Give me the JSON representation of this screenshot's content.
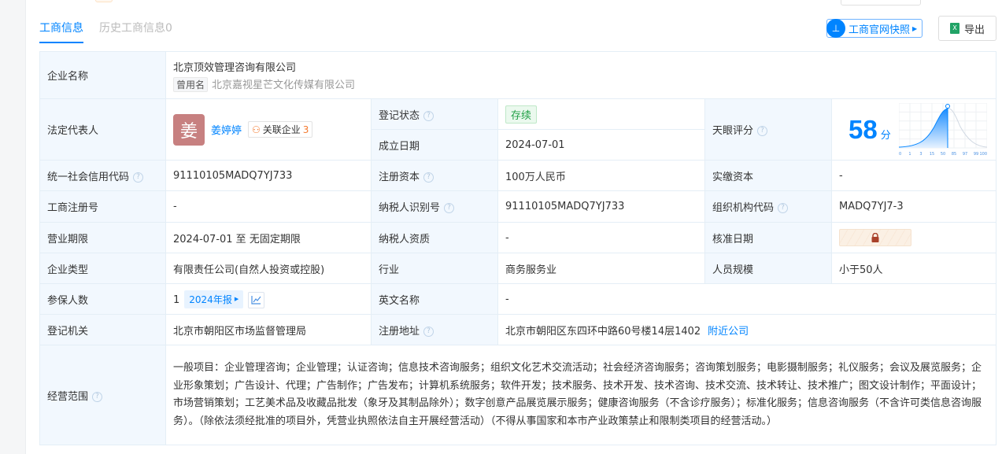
{
  "tabs": [
    {
      "label": "工商信息"
    },
    {
      "label": "历史工商信息0"
    }
  ],
  "actions": {
    "snapshot": "工商官网快照",
    "export": "导出"
  },
  "company": {
    "label": "企业名称",
    "name": "北京顶效管理咨询有限公司",
    "used_name_tag": "曾用名",
    "used_name": "北京嘉视星芒文化传媒有限公司"
  },
  "legal": {
    "label": "法定代表人",
    "avatar_char": "姜",
    "name": "姜婷婷",
    "related_label": "关联企业",
    "related_count": "3"
  },
  "status": {
    "label": "登记状态",
    "value": "存续"
  },
  "founded": {
    "label": "成立日期",
    "value": "2024-07-01"
  },
  "score": {
    "label": "天眼评分",
    "value": "58",
    "unit": "分",
    "ticks": [
      "0",
      "1",
      "3",
      "15",
      "50",
      "85",
      "97",
      "99",
      "100"
    ]
  },
  "rows": {
    "credit": {
      "label": "统一社会信用代码",
      "value": "91110105MADQ7YJ733"
    },
    "capital": {
      "label": "注册资本",
      "value": "100万人民币"
    },
    "paid": {
      "label": "实缴资本",
      "value": "-"
    },
    "regno": {
      "label": "工商注册号",
      "value": "-"
    },
    "taxid": {
      "label": "纳税人识别号",
      "value": "91110105MADQ7YJ733"
    },
    "orgcode": {
      "label": "组织机构代码",
      "value": "MADQ7YJ7-3"
    },
    "term": {
      "label": "营业期限",
      "value": "2024-07-01 至 无固定期限"
    },
    "taxq": {
      "label": "纳税人资质",
      "value": "-"
    },
    "approve": {
      "label": "核准日期"
    },
    "type": {
      "label": "企业类型",
      "value": "有限责任公司(自然人投资或控股)"
    },
    "industry": {
      "label": "行业",
      "value": "商务服务业"
    },
    "staff": {
      "label": "人员规模",
      "value": "小于50人"
    },
    "insured": {
      "label": "参保人数",
      "value": "1",
      "report": "2024年报"
    },
    "en": {
      "label": "英文名称",
      "value": "-"
    },
    "authority": {
      "label": "登记机关",
      "value": "北京市朝阳区市场监督管理局"
    },
    "addr": {
      "label": "注册地址",
      "value": "北京市朝阳区东四环中路60号楼14层1402",
      "nearby": "附近公司"
    },
    "scope": {
      "label": "经营范围",
      "value": "一般项目：企业管理咨询；企业管理；认证咨询；信息技术咨询服务；组织文化艺术交流活动；社会经济咨询服务；咨询策划服务；电影摄制服务；礼仪服务；会议及展览服务；企业形象策划；广告设计、代理；广告制作；广告发布；计算机系统服务；软件开发；技术服务、技术开发、技术咨询、技术交流、技术转让、技术推广；图文设计制作；平面设计；市场营销策划；工艺美术品及收藏品批发（象牙及其制品除外）；数字创意产品展览展示服务；健康咨询服务（不含诊疗服务）；标准化服务；信息咨询服务（不含许可类信息咨询服务）。（除依法须经批准的项目外，凭营业执照依法自主开展经营活动）（不得从事国家和本市产业政策禁止和限制类项目的经营活动。）"
    }
  }
}
